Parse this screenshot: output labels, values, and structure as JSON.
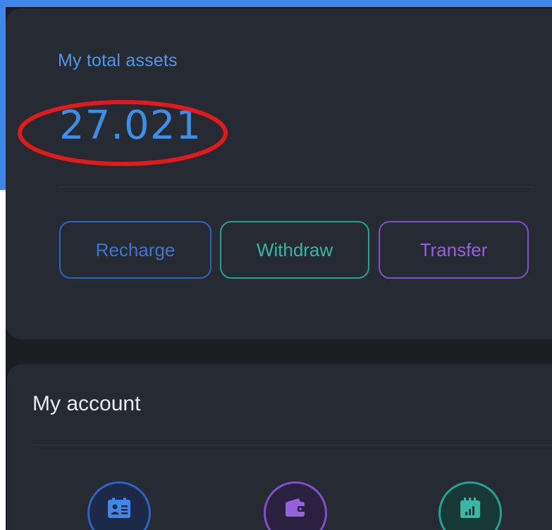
{
  "assets": {
    "label": "My total assets",
    "value": "27.021"
  },
  "actions": {
    "recharge_label": "Recharge",
    "withdraw_label": "Withdraw",
    "transfer_label": "Transfer"
  },
  "account": {
    "title": "My account",
    "icons": [
      "profile-card-icon",
      "wallet-icon",
      "calendar-chart-icon"
    ]
  },
  "colors": {
    "accent_blue": "#3d8fe6",
    "withdraw_teal": "#37b8a4",
    "transfer_purple": "#9661de",
    "highlight_red": "#e01b1b",
    "card_bg": "#262a33",
    "page_bg": "#1b1d22"
  }
}
